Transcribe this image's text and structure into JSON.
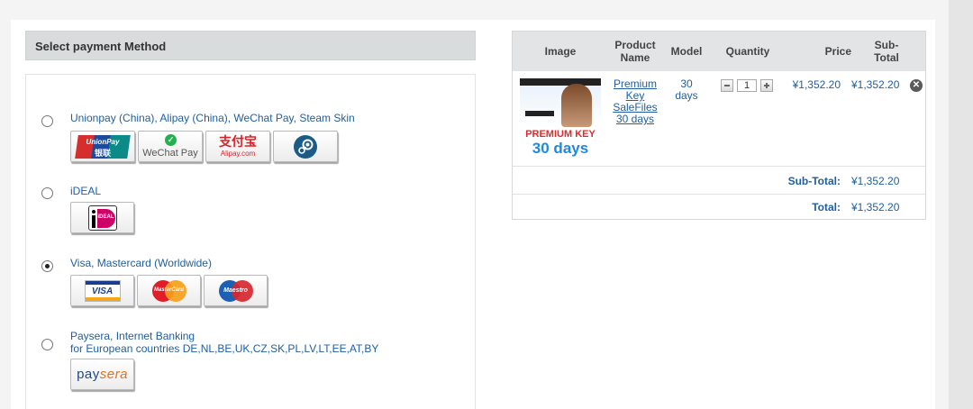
{
  "payment": {
    "title": "Select payment Method",
    "options": [
      {
        "label": "Unionpay (China), Alipay (China), WeChat Pay, Steam Skin",
        "checked": false,
        "logos": {
          "unionpay_top": "UnionPay",
          "unionpay_bottom": "银联",
          "wechat": "WeChat Pay",
          "alipay_top": "支付宝",
          "alipay_bottom": "Alipay.com"
        }
      },
      {
        "label": "iDEAL",
        "checked": false,
        "logos": {
          "ideal": "iDEAL"
        }
      },
      {
        "label": "Visa, Mastercard (Worldwide)",
        "checked": true,
        "logos": {
          "visa": "VISA",
          "mastercard": "MasterCard",
          "maestro": "Maestro"
        }
      },
      {
        "label_line1": "Paysera, Internet Banking",
        "label_line2": "for European countries DE,NL,BE,UK,CZ,SK,PL,LV,LT,EE,AT,BY",
        "checked": false,
        "logos": {
          "paysera_a": "pay",
          "paysera_b": "sera"
        }
      }
    ]
  },
  "cart": {
    "headers": {
      "image": "Image",
      "product_l1": "Product",
      "product_l2": "Name",
      "model": "Model",
      "quantity": "Quantity",
      "price": "Price",
      "subtotal_l1": "Sub-",
      "subtotal_l2": "Total"
    },
    "item": {
      "name_lines": [
        "Premium",
        "Key",
        "SaleFiles",
        "30 days"
      ],
      "model_lines": [
        "30",
        "days"
      ],
      "quantity": "1",
      "price": "¥1,352.20",
      "subtotal": "¥1,352.20",
      "thumb_text_top": "PREMIUM KEY",
      "thumb_text_bottom": "30 days"
    },
    "subtotal_label": "Sub-Total:",
    "subtotal_value": "¥1,352.20",
    "total_label": "Total:",
    "total_value": "¥1,352.20"
  },
  "colors": {
    "link": "#1f5fa0",
    "header_bg": "#d9dcdd",
    "accent_red": "#d32f2f",
    "accent_blue": "#1e88e5"
  }
}
